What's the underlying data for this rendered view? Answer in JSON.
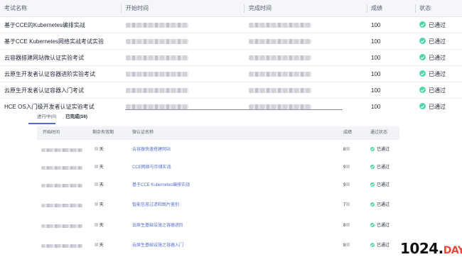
{
  "main_table": {
    "columns": {
      "name": "考试名称",
      "start": "开始时间",
      "end": "完成时间",
      "score": "成绩",
      "status": "状态"
    },
    "rows": [
      {
        "name": "基于CCE的Kubernetes编排实战",
        "score": "100",
        "status": "已通过"
      },
      {
        "name": "基于CCE Kubernetes网络实战考试实验",
        "score": "100",
        "status": "已通过"
      },
      {
        "name": "云容器搭建网站微认证实验考试",
        "score": "100",
        "status": "已通过"
      },
      {
        "name": "云原生开发者认证容器进阶实验考试",
        "score": "100",
        "status": "已通过"
      },
      {
        "name": "云原生开发者认证容器入门考试",
        "score": "100",
        "status": "已通过"
      },
      {
        "name": "HCE OS入门级开发者认证实验考试",
        "score": "100",
        "status": "已通过"
      }
    ]
  },
  "panel": {
    "tabs": {
      "in_progress": "进行中(0)",
      "passed": "已完成(16)"
    },
    "columns": {
      "start": "开始时间",
      "validity": "剩余有效期",
      "name": "微认证名称",
      "score": "成绩",
      "status": "通过状态"
    },
    "rows": [
      {
        "validity": "天",
        "name": "云容器快速搭建网站",
        "score": "8",
        "status": "已通过"
      },
      {
        "validity": "天",
        "name": "CCE网络与存储实战",
        "score": "9",
        "status": "已通过"
      },
      {
        "validity": "天",
        "name": "基于CCE Kubernetes编排实战",
        "score": "9",
        "status": "已通过"
      },
      {
        "validity": "天",
        "name": "智能信息过滤和图片鉴别",
        "score": "7",
        "status": "已通过"
      },
      {
        "validity": "天",
        "name": "云原生基础设施之容器进阶",
        "score": "8",
        "status": "已通过"
      },
      {
        "validity": "天",
        "name": "云原生基础设施之容器入门",
        "score": "8",
        "status": "已通过"
      }
    ]
  },
  "watermark": {
    "number": "1024.",
    "suffix": "DAY"
  },
  "colors": {
    "accent": "#526ecc",
    "success": "#50d4ab",
    "header_bg": "#f5f6f9"
  },
  "icons": [
    "check-circle-icon"
  ]
}
